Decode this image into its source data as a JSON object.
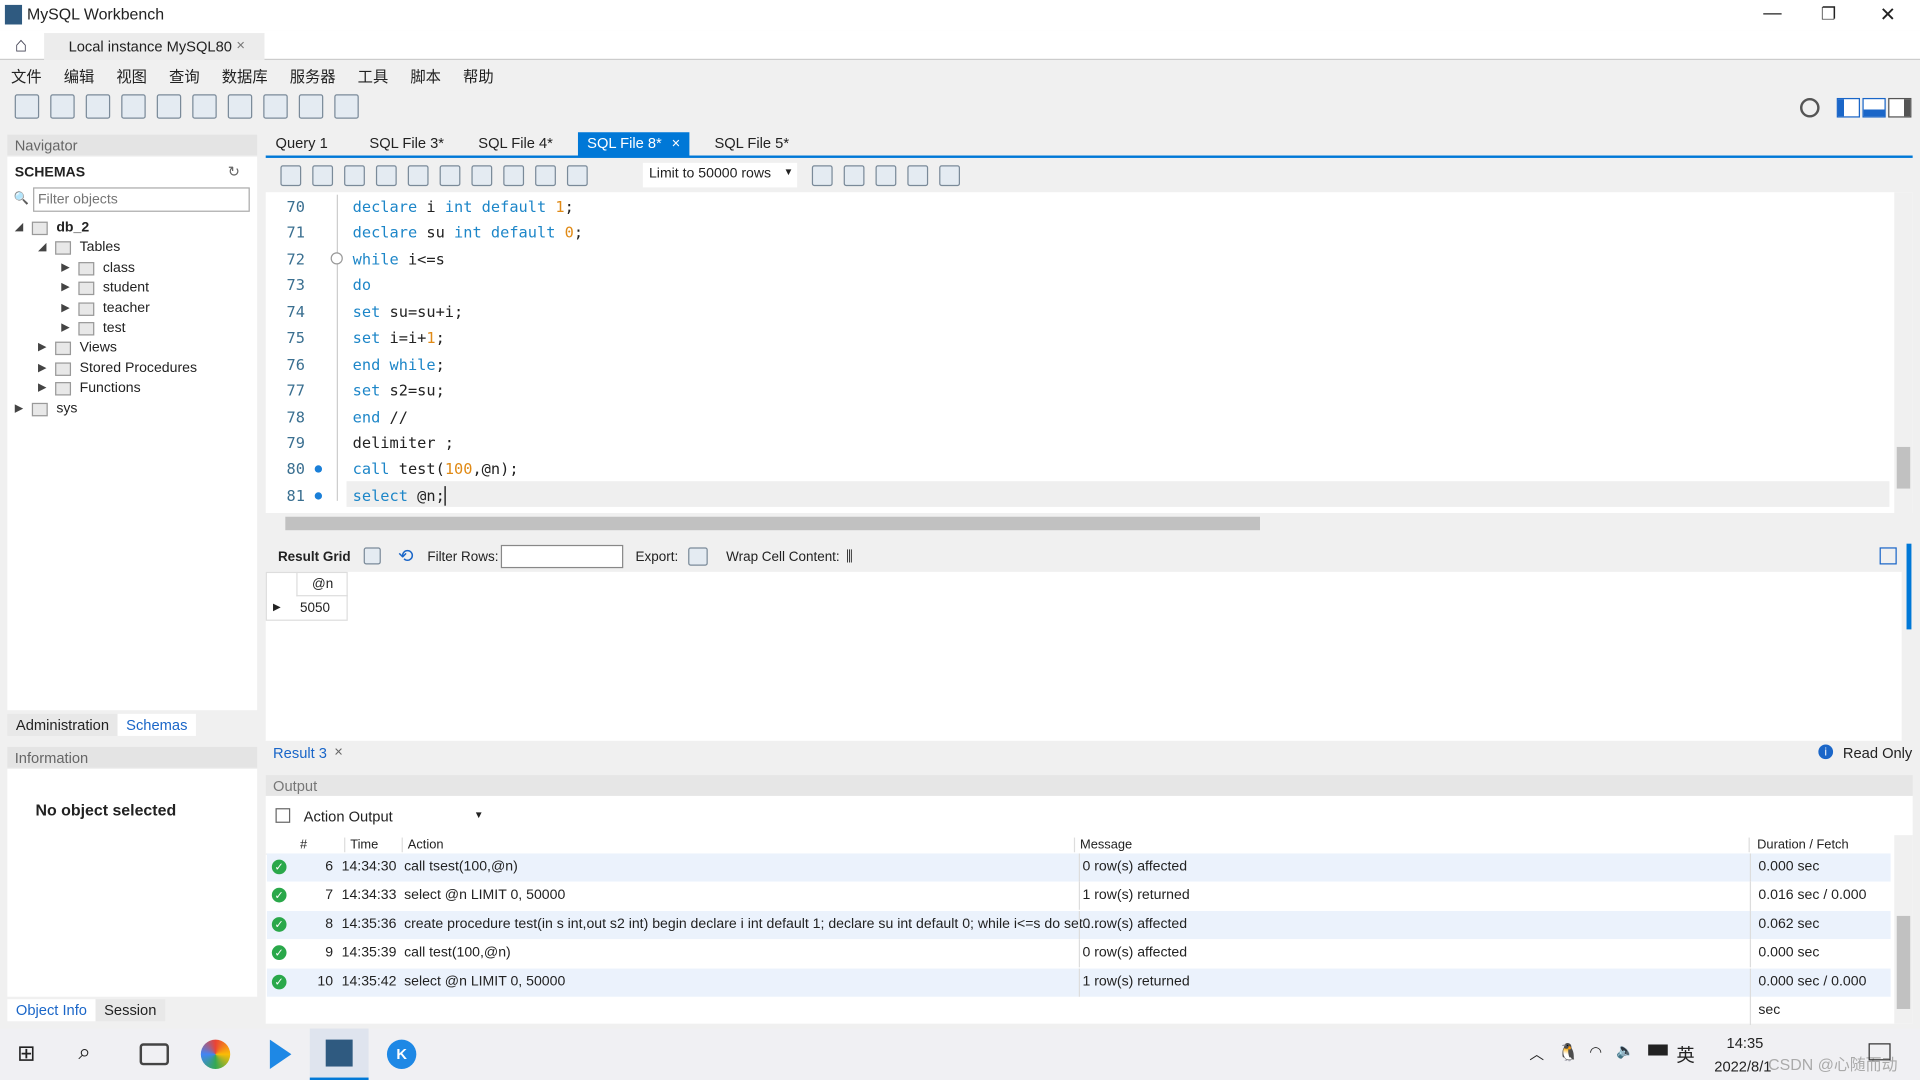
{
  "window": {
    "title": "MySQL Workbench",
    "controls": [
      "minimize",
      "restore",
      "close"
    ]
  },
  "conn_tab": {
    "label": "Local instance MySQL80"
  },
  "menu": [
    "文件",
    "编辑",
    "视图",
    "查询",
    "数据库",
    "服务器",
    "工具",
    "脚本",
    "帮助"
  ],
  "navigator": {
    "header": "Navigator",
    "schemas_title": "SCHEMAS",
    "filter_placeholder": "Filter objects",
    "tree": [
      {
        "label": "db_2",
        "level": 0,
        "bold": true
      },
      {
        "label": "Tables",
        "level": 1
      },
      {
        "label": "class",
        "level": 2
      },
      {
        "label": "student",
        "level": 2
      },
      {
        "label": "teacher",
        "level": 2
      },
      {
        "label": "test",
        "level": 2
      },
      {
        "label": "Views",
        "level": 1
      },
      {
        "label": "Stored Procedures",
        "level": 1
      },
      {
        "label": "Functions",
        "level": 1
      },
      {
        "label": "sys",
        "level": 0
      }
    ],
    "tabs": [
      "Administration",
      "Schemas"
    ],
    "info_header": "Information",
    "no_object": "No object selected",
    "bottom_tabs": [
      "Object Info",
      "Session"
    ]
  },
  "editor": {
    "tabs": [
      "Query 1",
      "SQL File 3*",
      "SQL File 4*",
      "SQL File 8*",
      "SQL File 5*"
    ],
    "active_tab": 3,
    "limit": "Limit to 50000 rows",
    "lines": [
      {
        "n": "70",
        "html": "<span class='kw'>declare</span> i <span class='kw'>int</span> <span class='kw'>default</span> <span class='num'>1</span>;"
      },
      {
        "n": "71",
        "html": "<span class='kw'>declare</span> su <span class='kw'>int</span> <span class='kw'>default</span> <span class='num'>0</span>;"
      },
      {
        "n": "72",
        "html": "<span class='kw'>while</span> i&lt;=s"
      },
      {
        "n": "73",
        "html": "<span class='kw'>do</span>"
      },
      {
        "n": "74",
        "html": "<span class='kw'>set</span> su=su+i;"
      },
      {
        "n": "75",
        "html": "<span class='kw'>set</span> i=i+<span class='num'>1</span>;"
      },
      {
        "n": "76",
        "html": "<span class='kw'>end</span> <span class='kw'>while</span>;"
      },
      {
        "n": "77",
        "html": "<span class='kw'>set</span> s2=su;"
      },
      {
        "n": "78",
        "html": "<span class='kw'>end</span> //"
      },
      {
        "n": "79",
        "html": "delimiter ;"
      },
      {
        "n": "80",
        "html": "<span class='kw'>call</span> test(<span class='num'>100</span>,@n);"
      },
      {
        "n": "81",
        "html": "<span class='kw'>select</span> @n;"
      }
    ]
  },
  "result": {
    "grid_label": "Result Grid",
    "filter_label": "Filter Rows:",
    "export_label": "Export:",
    "wrap_label": "Wrap Cell Content:",
    "column": "@n",
    "value": "5050",
    "tab": "Result 3",
    "read_only": "Read Only"
  },
  "output": {
    "header": "Output",
    "selector": "Action Output",
    "columns": [
      "#",
      "Time",
      "Action",
      "Message",
      "Duration / Fetch"
    ],
    "rows": [
      {
        "n": "6",
        "time": "14:34:30",
        "action": "call tsest(100,@n)",
        "message": "0 row(s) affected",
        "duration": "0.000 sec"
      },
      {
        "n": "7",
        "time": "14:34:33",
        "action": "select @n LIMIT 0, 50000",
        "message": "1 row(s) returned",
        "duration": "0.016 sec / 0.000 sec"
      },
      {
        "n": "8",
        "time": "14:35:36",
        "action": "create procedure test(in s int,out s2 int) begin  declare i int default 1; declare su int default 0; while i<=s do  set ...",
        "message": "0 row(s) affected",
        "duration": "0.062 sec"
      },
      {
        "n": "9",
        "time": "14:35:39",
        "action": "call test(100,@n)",
        "message": "0 row(s) affected",
        "duration": "0.000 sec"
      },
      {
        "n": "10",
        "time": "14:35:42",
        "action": "select @n LIMIT 0, 50000",
        "message": "1 row(s) returned",
        "duration": "0.000 sec / 0.000 sec"
      }
    ]
  },
  "taskbar": {
    "time": "14:35",
    "date": "2022/8/1",
    "ime": "英",
    "watermark": "CSDN @心随而动"
  },
  "colors": {
    "accent": "#0078d7",
    "keyword": "#1d86c8",
    "number": "#e08a16",
    "success": "#2aa84a"
  }
}
